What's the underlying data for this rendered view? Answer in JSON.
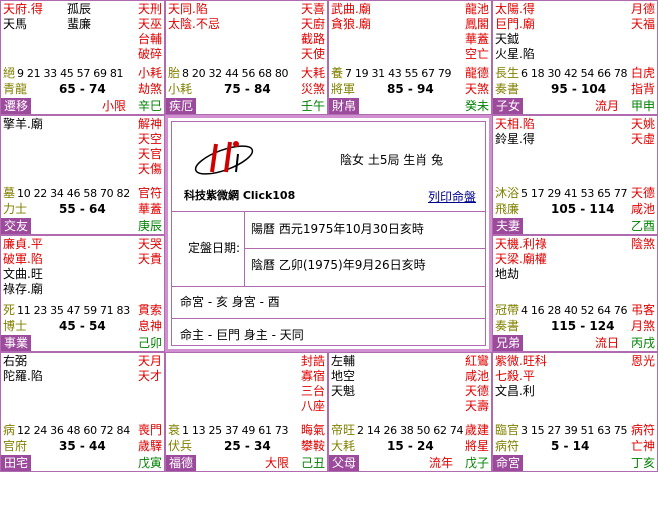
{
  "cells": [
    {
      "id": "c00",
      "left": [
        {
          "t": "天府.得",
          "c": "red"
        },
        {
          "t": "天馬",
          "c": "blk"
        }
      ],
      "mid": [
        {
          "t": "孤辰"
        },
        {
          "t": "蜚廉"
        }
      ],
      "right": [
        {
          "t": "天刑",
          "c": "red"
        },
        {
          "t": "天巫",
          "c": "red"
        },
        {
          "t": "台輔",
          "c": "red"
        },
        {
          "t": "破碎",
          "c": "red"
        }
      ],
      "stage": "絕",
      "nums": "9 21 33 45 57 69 81",
      "star12": "小耗",
      "god": "青龍",
      "range": "65 - 74",
      "sha": "劫煞",
      "palace": "遷移",
      "flow": "小限",
      "stem": "辛巳"
    },
    {
      "id": "c01",
      "left": [
        {
          "t": "天同.陷",
          "c": "red"
        },
        {
          "t": "太陰.不忌",
          "c": "red"
        }
      ],
      "mid": [],
      "right": [
        {
          "t": "天喜",
          "c": "red"
        },
        {
          "t": "天廚",
          "c": "red"
        },
        {
          "t": "截路",
          "c": "red"
        },
        {
          "t": "天使",
          "c": "red"
        }
      ],
      "stage": "胎",
      "nums": "8 20 32 44 56 68 80",
      "star12": "大耗",
      "god": "小耗",
      "range": "75 - 84",
      "sha": "災煞",
      "palace": "疾厄",
      "flow": "",
      "stem": "壬午"
    },
    {
      "id": "c02",
      "left": [
        {
          "t": "武曲.廟",
          "c": "red"
        },
        {
          "t": "貪狼.廟",
          "c": "red"
        }
      ],
      "mid": [],
      "right": [
        {
          "t": "龍池",
          "c": "red"
        },
        {
          "t": "鳳閣",
          "c": "red"
        },
        {
          "t": "華蓋",
          "c": "red"
        },
        {
          "t": "空亡",
          "c": "red"
        }
      ],
      "stage": "養",
      "nums": "7 19 31 43 55 67 79",
      "star12": "龍德",
      "god": "將軍",
      "range": "85 - 94",
      "sha": "天煞",
      "palace": "財帛",
      "flow": "",
      "stem": "癸未"
    },
    {
      "id": "c03",
      "left": [
        {
          "t": "太陽.得",
          "c": "red"
        },
        {
          "t": "巨門.廟",
          "c": "red"
        },
        {
          "t": "天鉞",
          "c": "blk"
        },
        {
          "t": "火星.陷",
          "c": "blk"
        }
      ],
      "mid": [],
      "right": [
        {
          "t": "月德",
          "c": "red"
        },
        {
          "t": "天福",
          "c": "red"
        }
      ],
      "stage": "長生",
      "nums": "6 18 30 42 54 66 78",
      "star12": "白虎",
      "god": "奏書",
      "range": "95 - 104",
      "sha": "指背",
      "palace": "子女",
      "flow": "流月",
      "stem": "甲申"
    },
    {
      "id": "c10",
      "left": [
        {
          "t": "擎羊.廟",
          "c": "blk"
        }
      ],
      "mid": [],
      "right": [
        {
          "t": "解神",
          "c": "red"
        },
        {
          "t": "天空",
          "c": "red"
        },
        {
          "t": "天官",
          "c": "red"
        },
        {
          "t": "天傷",
          "c": "red"
        }
      ],
      "stage": "墓",
      "nums": "10 22 34 46 58 70 82",
      "star12": "官符",
      "god": "力士",
      "range": "55 - 64",
      "sha": "華蓋",
      "palace": "交友",
      "flow": "",
      "stem": "庚辰"
    },
    {
      "id": "c13",
      "left": [
        {
          "t": "天相.陷",
          "c": "red"
        },
        {
          "t": "鈴星.得",
          "c": "blk"
        }
      ],
      "mid": [],
      "right": [
        {
          "t": "天姚",
          "c": "red"
        },
        {
          "t": "天虛",
          "c": "red"
        }
      ],
      "stage": "沐浴",
      "nums": "5 17 29 41 53 65 77",
      "star12": "天德",
      "god": "飛廉",
      "range": "105 - 114",
      "sha": "咸池",
      "palace": "夫妻",
      "flow": "",
      "stem": "乙酉"
    },
    {
      "id": "c20",
      "left": [
        {
          "t": "廉貞.平",
          "c": "red"
        },
        {
          "t": "破軍.陷",
          "c": "red"
        },
        {
          "t": "文曲.旺",
          "c": "blk"
        },
        {
          "t": "祿存.廟",
          "c": "blk"
        }
      ],
      "mid": [],
      "right": [
        {
          "t": "天哭",
          "c": "red"
        },
        {
          "t": "天貴",
          "c": "red"
        }
      ],
      "stage": "死",
      "nums": "11 23 35 47 59 71 83",
      "star12": "貫索",
      "god": "博士",
      "range": "45 - 54",
      "sha": "息神",
      "palace": "事業",
      "flow": "",
      "stem": "己卯"
    },
    {
      "id": "c23",
      "left": [
        {
          "t": "天機.利祿",
          "c": "red"
        },
        {
          "t": "天梁.廟權",
          "c": "red"
        },
        {
          "t": "地劫",
          "c": "blk"
        }
      ],
      "mid": [],
      "right": [
        {
          "t": "陰煞",
          "c": "red"
        }
      ],
      "stage": "冠帶",
      "nums": "4 16 28 40 52 64 76",
      "star12": "弔客",
      "god": "奏書",
      "range": "115 - 124",
      "sha": "月煞",
      "palace": "兄弟",
      "flow": "流日",
      "stem": "丙戌"
    },
    {
      "id": "c30",
      "left": [
        {
          "t": "右弼",
          "c": "blk"
        },
        {
          "t": "陀羅.陷",
          "c": "blk"
        }
      ],
      "mid": [],
      "right": [
        {
          "t": "天月",
          "c": "red"
        },
        {
          "t": "天才",
          "c": "red"
        }
      ],
      "stage": "病",
      "nums": "12 24 36 48 60 72 84",
      "star12": "喪門",
      "god": "官府",
      "range": "35 - 44",
      "sha": "歲驛",
      "palace": "田宅",
      "flow": "",
      "stem": "戊寅"
    },
    {
      "id": "c31",
      "left": [],
      "mid": [],
      "right": [
        {
          "t": "封誥",
          "c": "red"
        },
        {
          "t": "寡宿",
          "c": "red"
        },
        {
          "t": "三台",
          "c": "red"
        },
        {
          "t": "八座",
          "c": "red"
        }
      ],
      "stage": "衰",
      "nums": "1 13 25 37 49 61 73",
      "star12": "晦氣",
      "god": "伏兵",
      "range": "25 - 34",
      "sha": "攀鞍",
      "palace": "福德",
      "flow": "大限",
      "stem": "己丑"
    },
    {
      "id": "c32",
      "left": [
        {
          "t": "左輔",
          "c": "blk"
        },
        {
          "t": "地空",
          "c": "blk"
        },
        {
          "t": "天魁",
          "c": "blk"
        }
      ],
      "mid": [],
      "right": [
        {
          "t": "紅鸞",
          "c": "red"
        },
        {
          "t": "咸池",
          "c": "red"
        },
        {
          "t": "天德",
          "c": "red"
        },
        {
          "t": "天壽",
          "c": "red"
        }
      ],
      "stage": "帝旺",
      "nums": "2 14 26 38 50 62 74",
      "star12": "歲建",
      "god": "大耗",
      "range": "15 - 24",
      "sha": "將星",
      "palace": "父母",
      "flow": "流年",
      "stem": "戊子"
    },
    {
      "id": "c33",
      "left": [
        {
          "t": "紫微.旺科",
          "c": "red"
        },
        {
          "t": "七殺.平",
          "c": "red"
        },
        {
          "t": "文昌.利",
          "c": "blk"
        }
      ],
      "mid": [],
      "right": [
        {
          "t": "恩光",
          "c": "red"
        }
      ],
      "stage": "臨官",
      "nums": "3 15 27 39 51 63 75",
      "star12": "病符",
      "god": "病符",
      "range": "5 - 14",
      "sha": "亡神",
      "palace": "命宮",
      "flow": "",
      "stem": "丁亥"
    }
  ],
  "center": {
    "logo_sub": "科技紫微網 Click108",
    "person": "陰女 土5局 生肖 兔",
    "print_link": "列印命盤",
    "date_label": "定盤日期:",
    "solar": "陽曆 西元1975年10月30日亥時",
    "lunar": "陰曆 乙卯(1975)年9月26日亥時",
    "ming": "命宮 - 亥 身宮 - 酉",
    "zhu": "命主 - 巨門 身主 - 天同"
  },
  "colors": {
    "border": "#b06ab0",
    "palace_bg": "#9c4a9c",
    "stage": "#808000",
    "red": "#e00000",
    "green": "#008000"
  }
}
